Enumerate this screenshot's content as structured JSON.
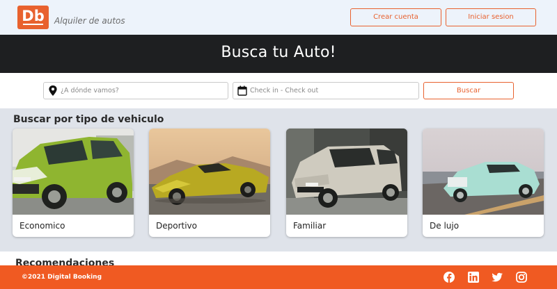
{
  "header": {
    "logo_text": "Db",
    "tagline": "Alquiler de autos",
    "create_account_label": "Crear cuenta",
    "login_label": "Iniciar sesion"
  },
  "banner": {
    "title": "Busca tu Auto!"
  },
  "search": {
    "destination_placeholder": "¿A dónde vamos?",
    "dates_placeholder": "Check in - Check out",
    "button_label": "Buscar"
  },
  "categories": {
    "title": "Buscar por tipo de vehiculo",
    "items": [
      {
        "label": "Economico",
        "image": "green-hatchback-photo"
      },
      {
        "label": "Deportivo",
        "image": "yellow-sports-car-photo"
      },
      {
        "label": "Familiar",
        "image": "silver-minivan-photo"
      },
      {
        "label": "De lujo",
        "image": "mint-luxury-sedan-photo"
      }
    ]
  },
  "recommendations": {
    "title": "Recomendaciones"
  },
  "footer": {
    "copyright": "©2021 Digital Booking",
    "social_icons": [
      "facebook-icon",
      "linkedin-icon",
      "twitter-icon",
      "instagram-icon"
    ]
  },
  "colors": {
    "brand": "#e8612e",
    "footer": "#f05a22",
    "banner": "#1e1f21",
    "header_bg": "#edf3fb",
    "section_bg": "#dfe3ea"
  }
}
